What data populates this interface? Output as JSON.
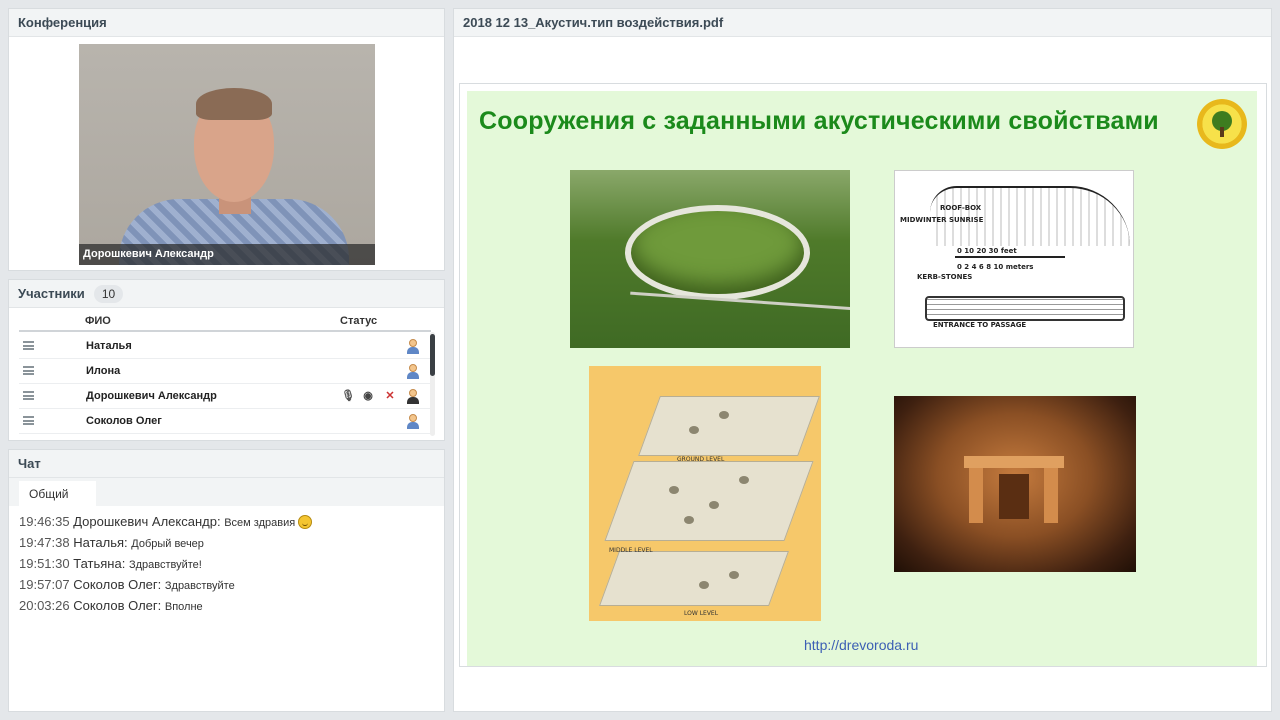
{
  "conference": {
    "title": "Конференция",
    "video_label": "Дорошкевич Александр"
  },
  "participants": {
    "title": "Участники",
    "count": "10",
    "col_name": "ФИО",
    "col_status": "Статус",
    "rows": [
      {
        "name": "Наталья"
      },
      {
        "name": "Илона"
      },
      {
        "name": "Дорошкевич Александр"
      },
      {
        "name": "Соколов  Олег"
      }
    ]
  },
  "chat": {
    "title": "Чат",
    "tab": "Общий",
    "messages": [
      {
        "time": "19:46:35",
        "author": "Дорошкевич Александр:",
        "text": "Всем здравия"
      },
      {
        "time": "19:47:38",
        "author": "Наталья:",
        "text": "Добрый вечер"
      },
      {
        "time": "19:51:30",
        "author": "Татьяна:",
        "text": "Здравствуйте!"
      },
      {
        "time": "19:57:07",
        "author": "Соколов  Олег:",
        "text": "Здравствуйте"
      },
      {
        "time": "20:03:26",
        "author": "Соколов  Олег:",
        "text": "Вполне"
      }
    ]
  },
  "document": {
    "title": "2018 12 13_Акустич.тип воздействия.pdf",
    "slide": {
      "heading": "Сооружения с заданными акустическими свойствами",
      "link": "http://drevoroda.ru",
      "diagram_labels": {
        "roof_box": "ROOF-BOX",
        "midwinter": "MIDWINTER SUNRISE",
        "scale": "0   10   20   30 feet",
        "scale2": "0  2  4  6  8  10  meters",
        "kerb": "KERB-STONES",
        "entrance": "ENTRANCE TO PASSAGE"
      },
      "map_labels": {
        "ground": "GROUND LEVEL",
        "middle": "MIDDLE LEVEL",
        "low": "LOW LEVEL"
      }
    }
  },
  "colors": {
    "slide_bg": "#e4f9d9",
    "heading": "#1b8a1b",
    "link": "#3c5fb4"
  }
}
